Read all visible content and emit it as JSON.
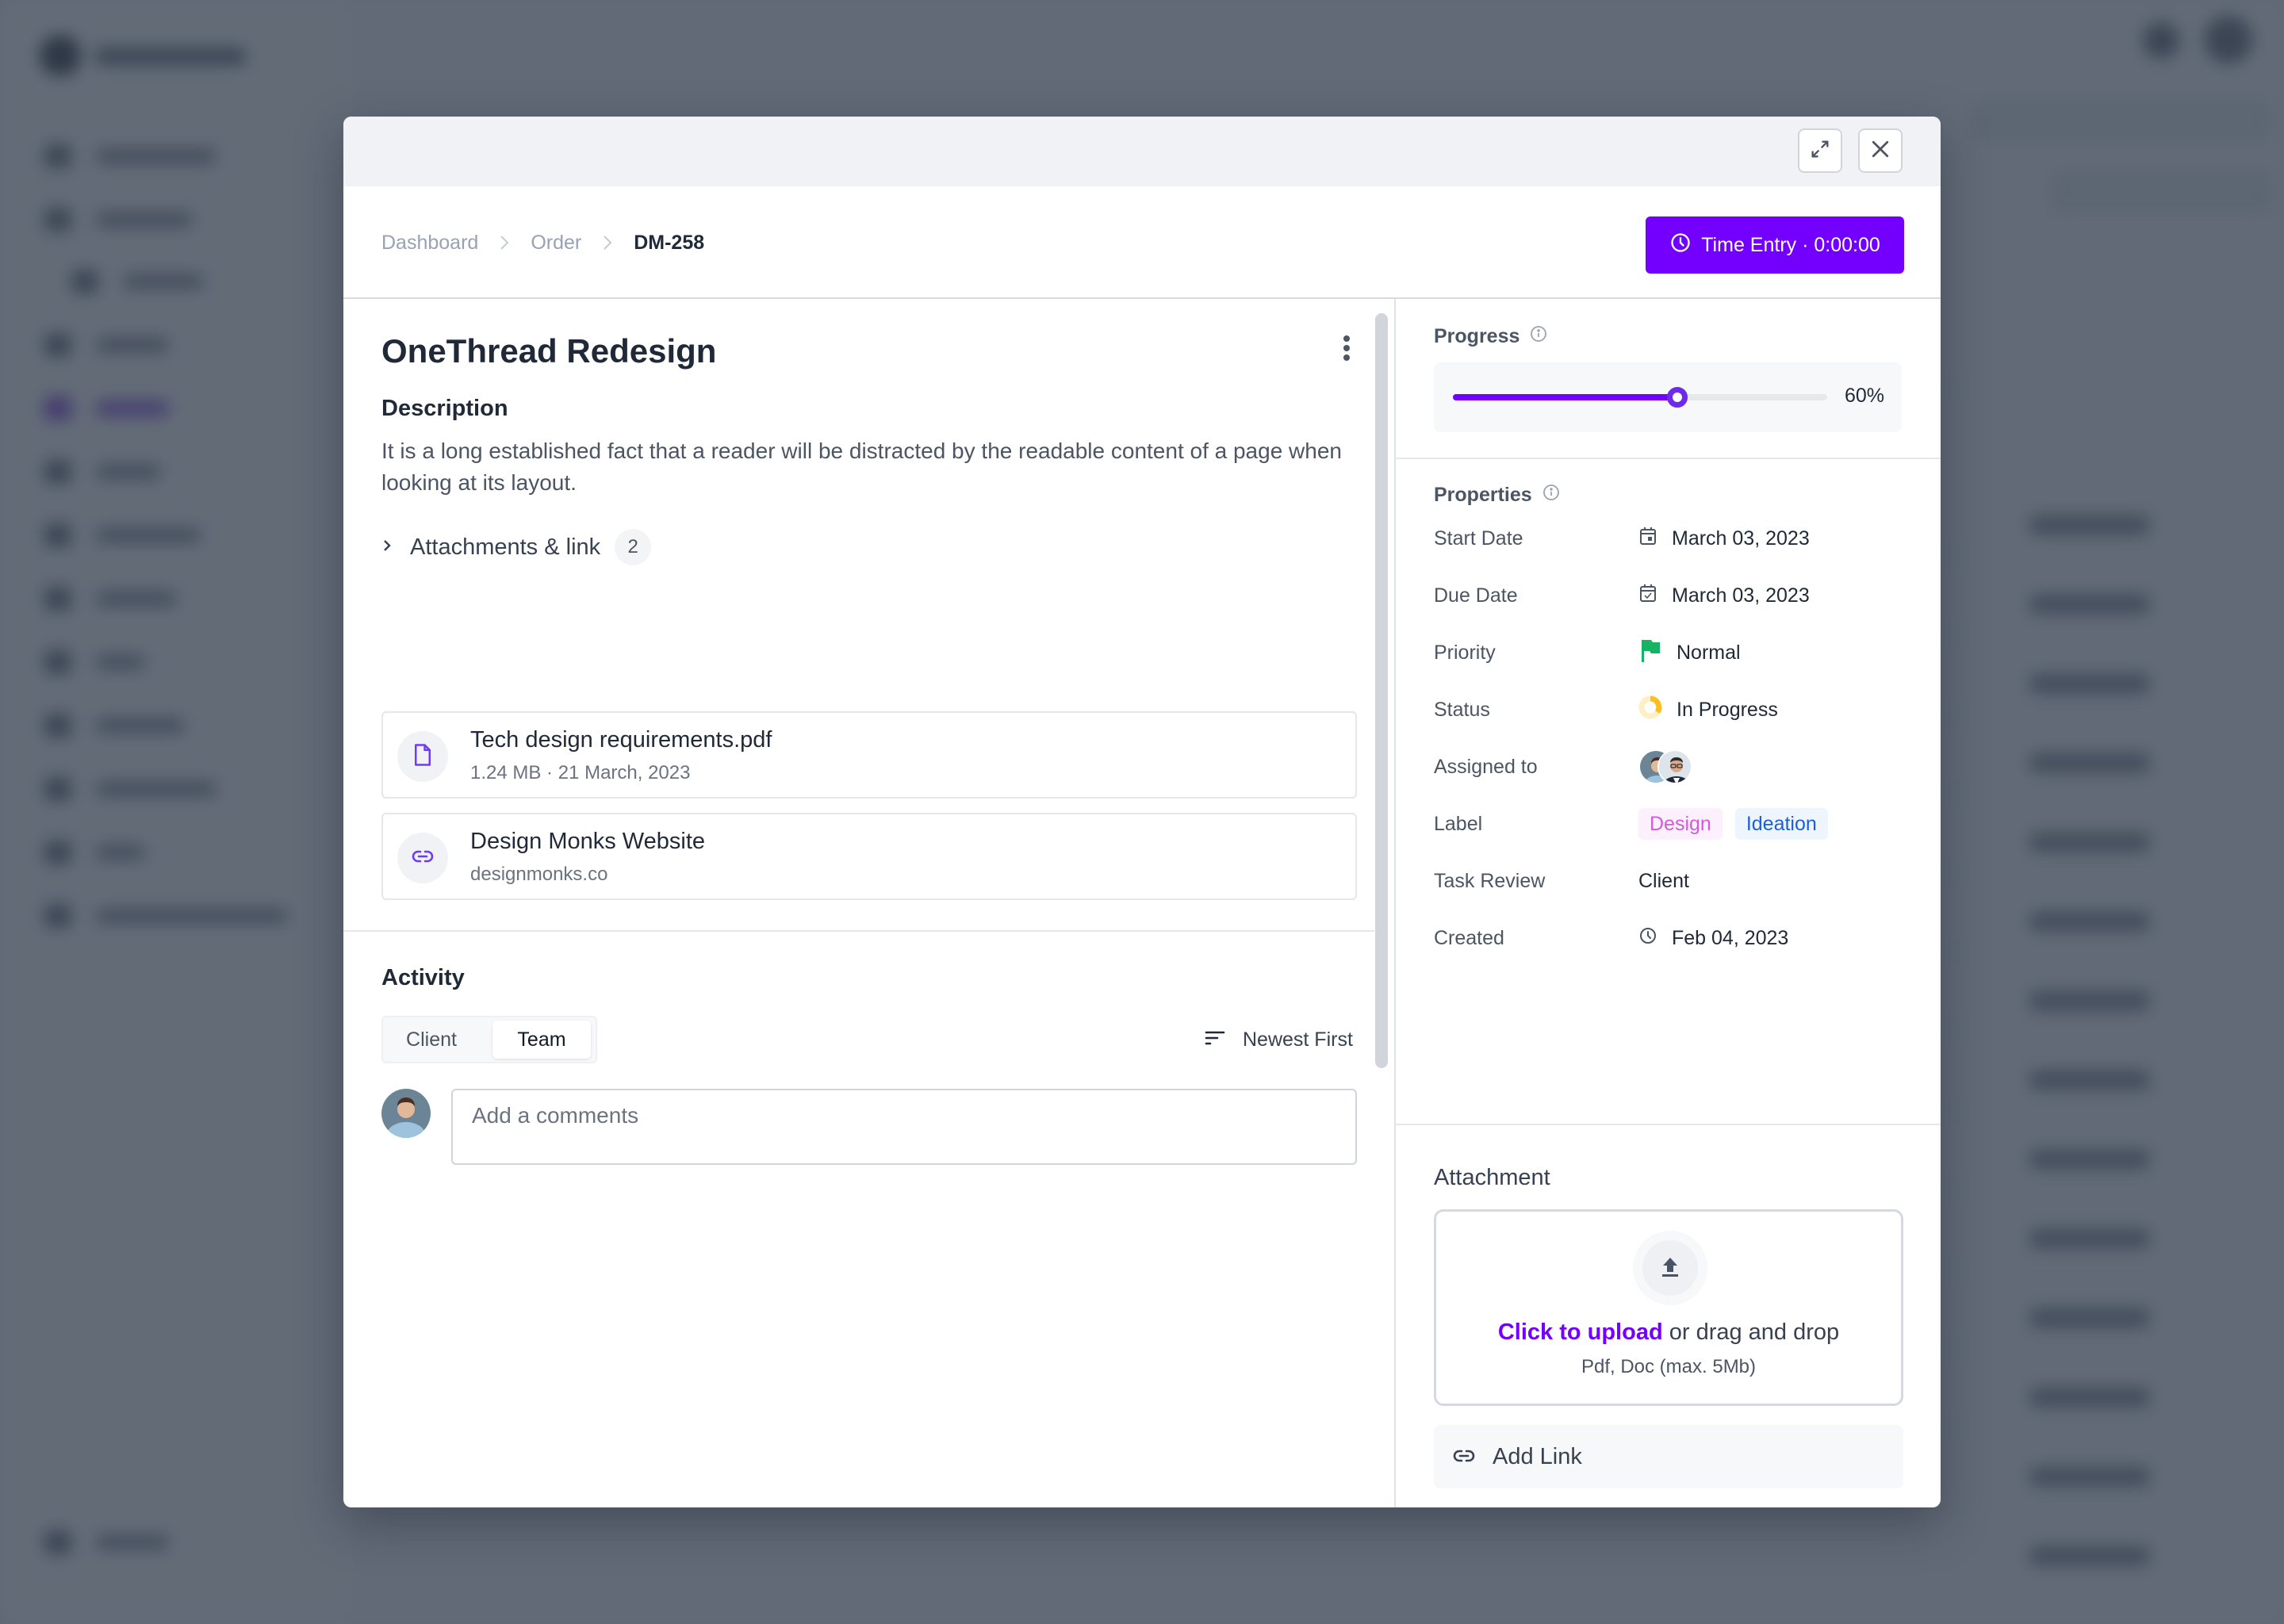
{
  "modal": {
    "header": {
      "expand_icon": "expand-arrows-icon",
      "close_icon": "close-x-icon"
    },
    "breadcrumb": [
      {
        "label": "Dashboard"
      },
      {
        "label": "Order"
      },
      {
        "label": "DM-258"
      }
    ],
    "time_entry": {
      "label": "Time Entry · 0:00:00",
      "icon": "clock-icon",
      "color": "#7300ff"
    },
    "task": {
      "title": "OneThread Redesign",
      "description_heading": "Description",
      "description": "It is a long established fact that a reader will be distracted by the readable content of a page when looking at its layout."
    },
    "attachments": {
      "label": "Attachments & link",
      "count": "2",
      "items": [
        {
          "name": "Tech design requirements.pdf",
          "meta": "1.24 MB · 21 March, 2023",
          "icon": "file-icon"
        },
        {
          "name": "Design Monks Website",
          "meta": "designmonks.co",
          "icon": "link-icon"
        }
      ]
    },
    "activity": {
      "heading": "Activity",
      "tabs": [
        {
          "label": "Client",
          "selected": false
        },
        {
          "label": "Team",
          "selected": true
        }
      ],
      "sort_label": "Newest First",
      "comment_placeholder": "Add a comments",
      "comment_value": ""
    },
    "progress": {
      "heading": "Progress",
      "value_percent": 60,
      "value_label": "60%"
    },
    "properties": {
      "heading": "Properties",
      "rows": [
        {
          "label": "Start Date",
          "value": "March 03, 2023",
          "icon": "calendar-icon"
        },
        {
          "label": "Due Date",
          "value": "March 03, 2023",
          "icon": "calendar-check-icon"
        },
        {
          "label": "Priority",
          "value": "Normal",
          "icon": "flag-icon",
          "color": "#16b364"
        },
        {
          "label": "Status",
          "value": "In Progress",
          "icon": "progress-ring-icon",
          "color": "#fbbf24"
        },
        {
          "label": "Assigned to",
          "avatars": 2
        },
        {
          "label": "Label",
          "tags": [
            {
              "text": "Design",
              "fg": "#d35ad8",
              "bg": "#fdf0fd"
            },
            {
              "text": "Ideation",
              "fg": "#1d5fd6",
              "bg": "#eef5ff"
            }
          ]
        },
        {
          "label": "Task Review",
          "value": "Client"
        },
        {
          "label": "Created",
          "value": "Feb 04, 2023",
          "icon": "clock-icon"
        }
      ]
    },
    "attachment_upload": {
      "heading": "Attachment",
      "link_text": "Click to upload",
      "rest_text": " or drag and drop",
      "hint": "Pdf, Doc  (max. 5Mb)",
      "add_link_label": "Add Link"
    }
  }
}
